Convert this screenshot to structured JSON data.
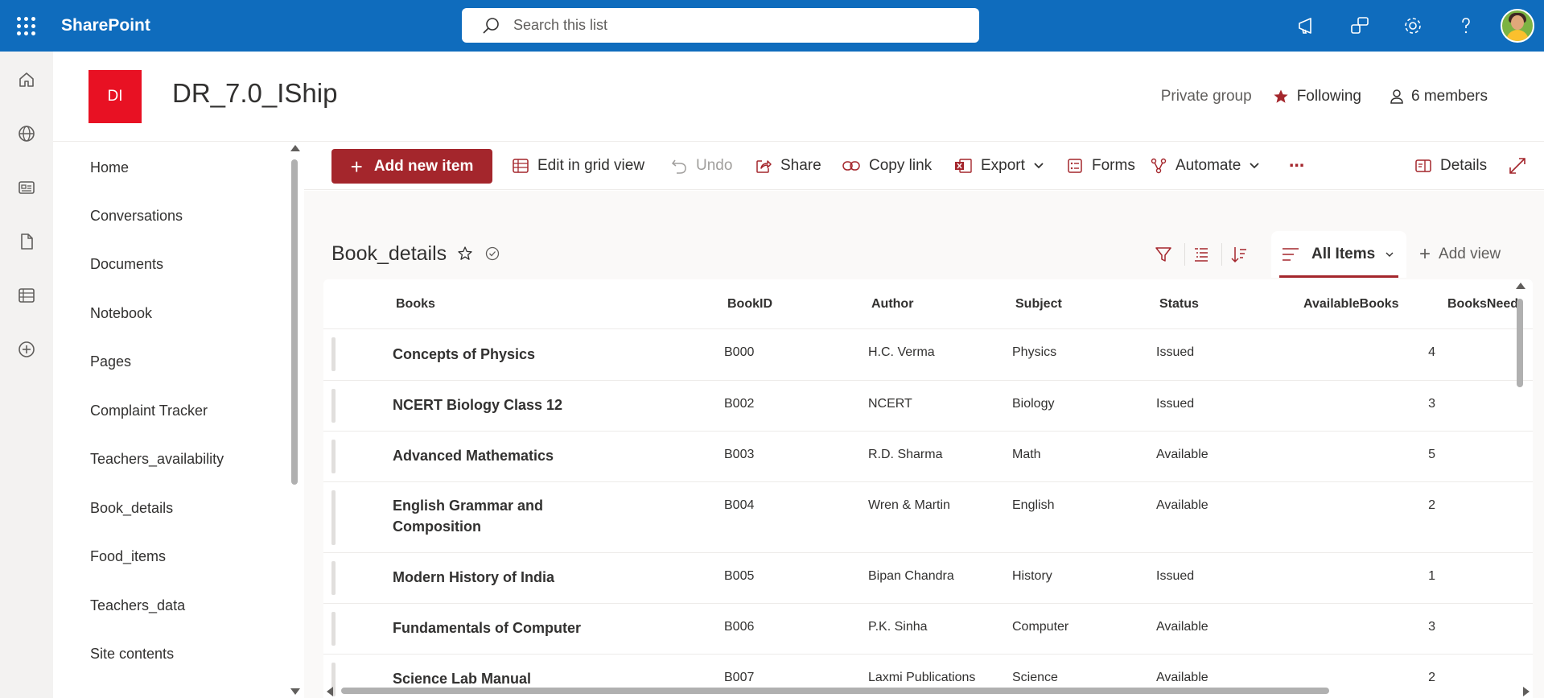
{
  "suite": {
    "brand": "SharePoint",
    "search_placeholder": "Search this list",
    "icons": [
      "megaphone-icon",
      "feedback-icon",
      "settings-icon",
      "help-icon"
    ]
  },
  "appbar": {
    "items": [
      "home-icon",
      "globe-icon",
      "news-icon",
      "document-icon",
      "list-icon",
      "add-circle-icon"
    ]
  },
  "site": {
    "logo_text": "DI",
    "title": "DR_7.0_IShip",
    "privacy": "Private group",
    "follow_label": "Following",
    "members_label": "6 members",
    "accent_color": "#a4262c"
  },
  "leftnav": {
    "items": [
      "Home",
      "Conversations",
      "Documents",
      "Notebook",
      "Pages",
      "Complaint Tracker",
      "Teachers_availability",
      "Book_details",
      "Food_items",
      "Teachers_data",
      "Site contents"
    ]
  },
  "commandbar": {
    "add_new": "Add new item",
    "edit_grid": "Edit in grid view",
    "undo": "Undo",
    "share": "Share",
    "copy_link": "Copy link",
    "export": "Export",
    "forms": "Forms",
    "automate": "Automate",
    "more": "⋯",
    "details": "Details"
  },
  "list": {
    "title": "Book_details",
    "view_name": "All Items",
    "add_view": "Add view",
    "columns": [
      "Books",
      "BookID",
      "Author",
      "Subject",
      "Status",
      "AvailableBooks",
      "BooksNeed"
    ],
    "rows": [
      {
        "books": "Concepts of Physics",
        "bookid": "B000",
        "author": "H.C. Verma",
        "subject": "Physics",
        "status": "Issued",
        "available": "4"
      },
      {
        "books": "NCERT Biology Class 12",
        "bookid": "B002",
        "author": "NCERT",
        "subject": "Biology",
        "status": "Issued",
        "available": "3"
      },
      {
        "books": "Advanced Mathematics",
        "bookid": "B003",
        "author": "R.D. Sharma",
        "subject": "Math",
        "status": "Available",
        "available": "5"
      },
      {
        "books": "English Grammar and Composition",
        "bookid": "B004",
        "author": "Wren & Martin",
        "subject": "English",
        "status": "Available",
        "available": "2"
      },
      {
        "books": "Modern History of India",
        "bookid": "B005",
        "author": "Bipan Chandra",
        "subject": "History",
        "status": "Issued",
        "available": "1"
      },
      {
        "books": "Fundamentals of Computer",
        "bookid": "B006",
        "author": "P.K. Sinha",
        "subject": "Computer",
        "status": "Available",
        "available": "3"
      },
      {
        "books": "Science Lab Manual",
        "bookid": "B007",
        "author": "Laxmi Publications",
        "subject": "Science",
        "status": "Available",
        "available": "2"
      }
    ]
  }
}
